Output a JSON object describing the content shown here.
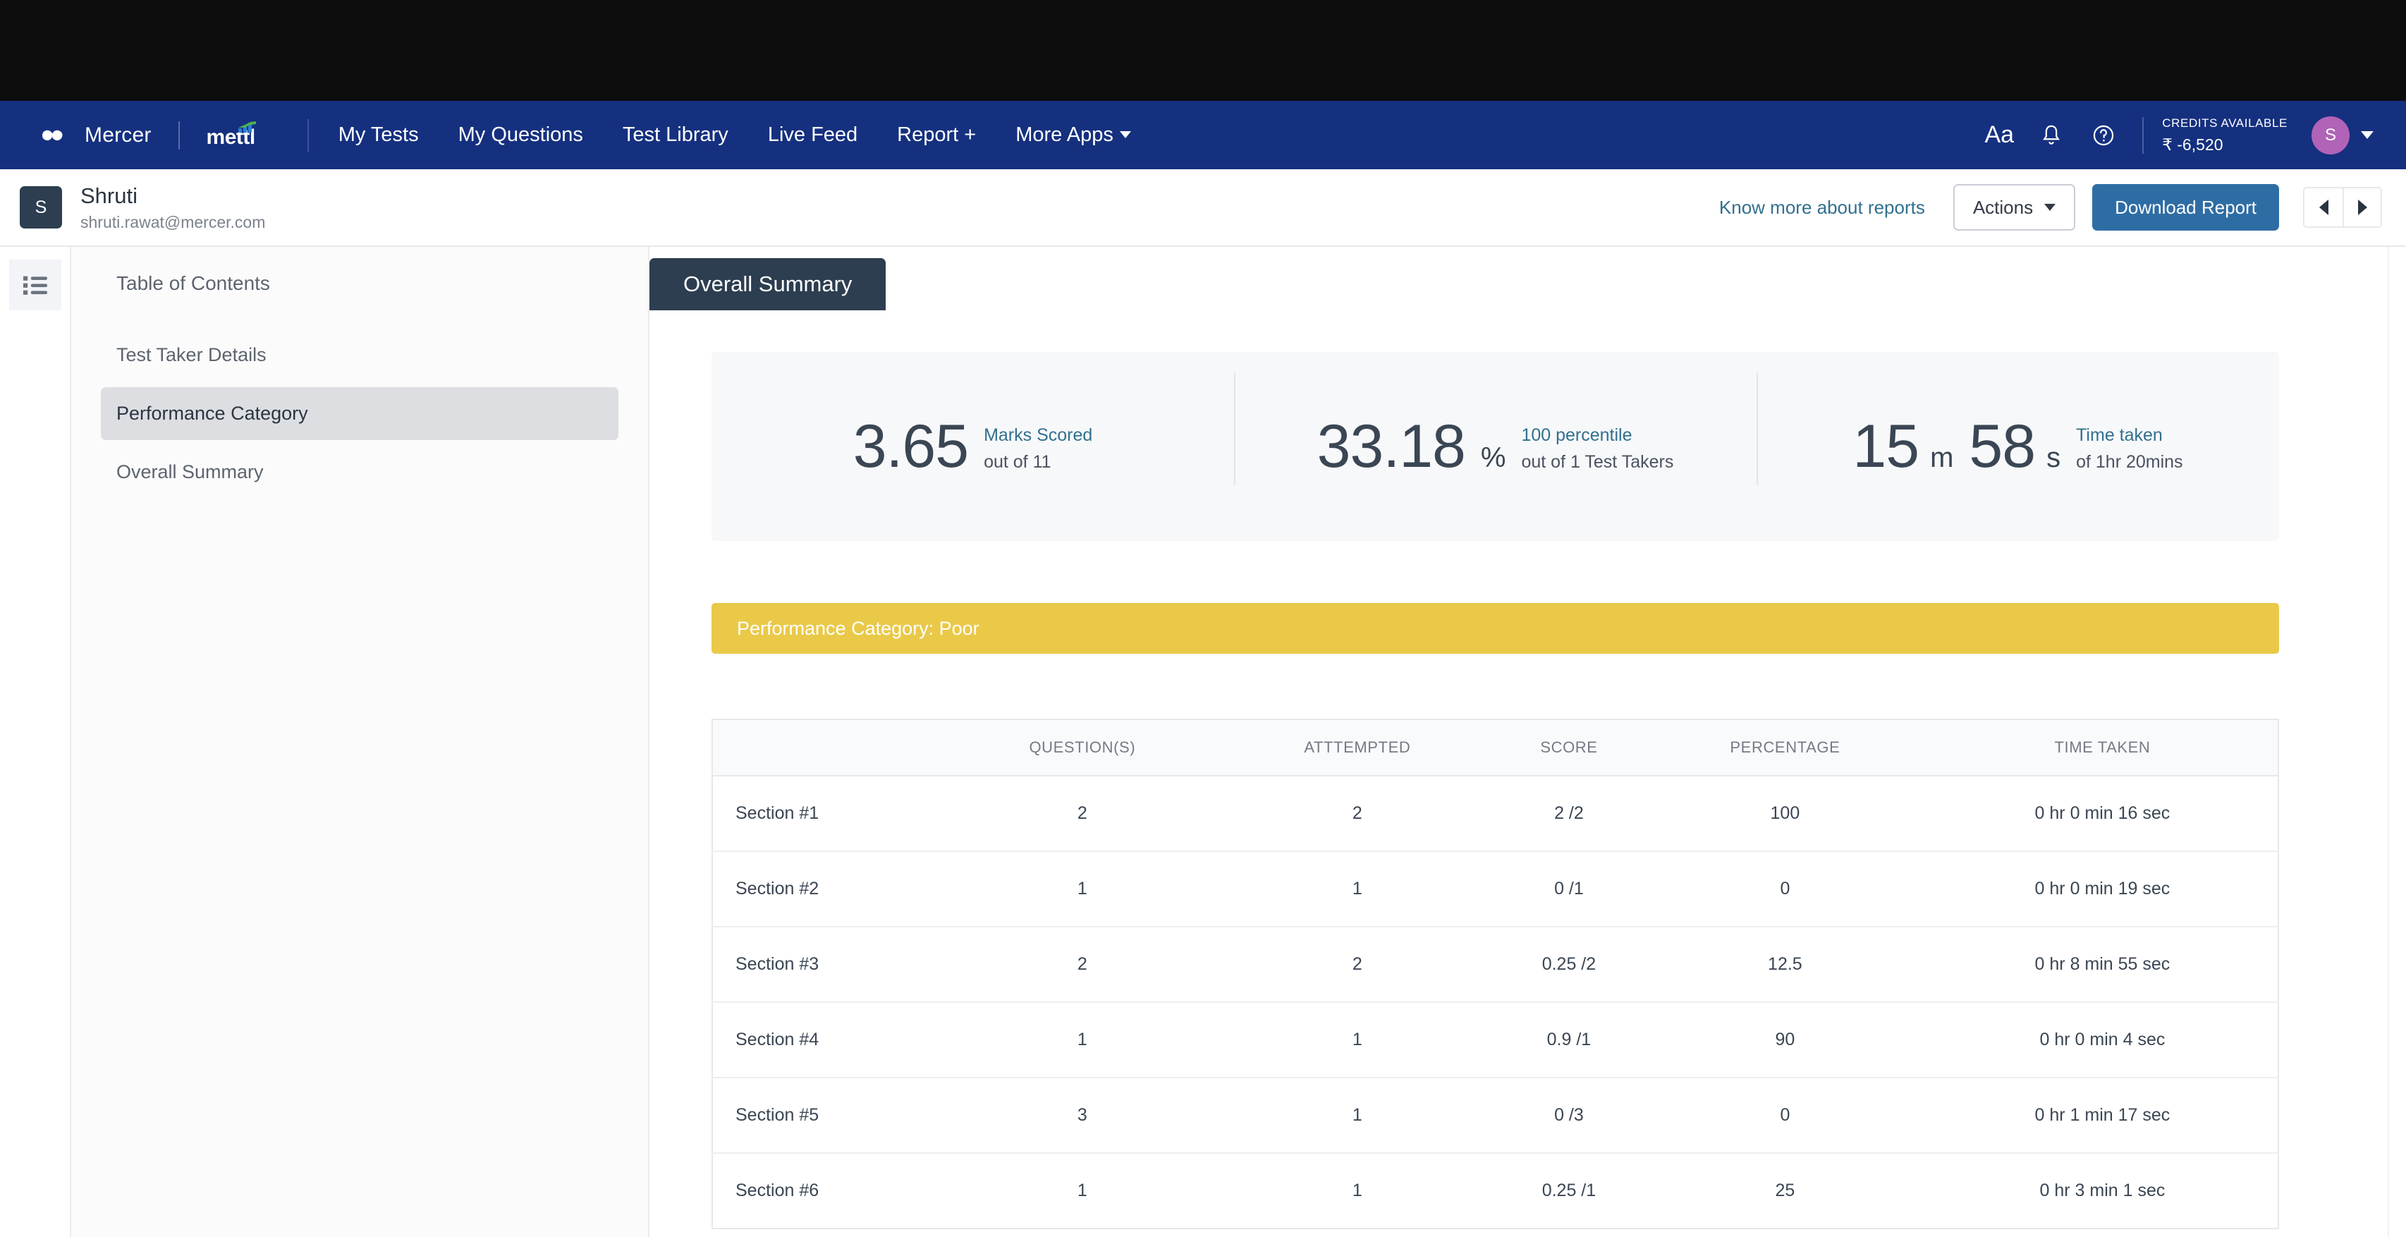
{
  "navbar": {
    "brand_mercer": "Mercer",
    "brand_mettl": "mettl",
    "links": [
      {
        "label": "My Tests",
        "has_caret": false
      },
      {
        "label": "My Questions",
        "has_caret": false
      },
      {
        "label": "Test Library",
        "has_caret": false
      },
      {
        "label": "Live Feed",
        "has_caret": false
      },
      {
        "label": "Report +",
        "has_caret": false
      },
      {
        "label": "More Apps",
        "has_caret": true
      }
    ],
    "icons": [
      "font-size-icon",
      "bell-icon",
      "help-icon"
    ],
    "font_icon_label": "Aa",
    "credits_label": "CREDITS AVAILABLE",
    "credits_value": "₹ -6,520",
    "avatar_initial": "S"
  },
  "user_header": {
    "avatar_initial": "S",
    "name": "Shruti",
    "email": "shruti.rawat@mercer.com",
    "know_more_label": "Know more about reports",
    "actions_label": "Actions",
    "download_label": "Download Report"
  },
  "sidebar": {
    "toc_title": "Table of Contents",
    "items": [
      {
        "label": "Test Taker Details",
        "active": false
      },
      {
        "label": "Performance Category",
        "active": true
      },
      {
        "label": "Overall Summary",
        "active": false
      }
    ]
  },
  "main": {
    "section_tab": "Overall Summary",
    "stats": [
      {
        "value": "3.65",
        "unit": "",
        "label1": "Marks Scored",
        "label2": "out of 11"
      },
      {
        "value": "33.18",
        "unit": "%",
        "label1": "100 percentile",
        "label2": "out of 1 Test Takers"
      },
      {
        "value_a": "15",
        "unit_a": "m",
        "value_b": "58",
        "unit_b": "s",
        "label1": "Time taken",
        "label2": "of 1hr 20mins"
      }
    ],
    "performance_banner": "Performance Category: Poor",
    "table": {
      "headers": [
        "",
        "QUESTION(S)",
        "ATTTEMPTED",
        "SCORE",
        "PERCENTAGE",
        "TIME TAKEN"
      ],
      "rows": [
        [
          "Section #1",
          "2",
          "2",
          "2 /2",
          "100",
          "0 hr 0 min 16 sec"
        ],
        [
          "Section #2",
          "1",
          "1",
          "0 /1",
          "0",
          "0 hr 0 min 19 sec"
        ],
        [
          "Section #3",
          "2",
          "2",
          "0.25 /2",
          "12.5",
          "0 hr 8 min 55 sec"
        ],
        [
          "Section #4",
          "1",
          "1",
          "0.9 /1",
          "90",
          "0 hr 0 min 4 sec"
        ],
        [
          "Section #5",
          "3",
          "1",
          "0 /3",
          "0",
          "0 hr 1 min 17 sec"
        ],
        [
          "Section #6",
          "1",
          "1",
          "0.25 /1",
          "25",
          "0 hr 3 min 1 sec"
        ]
      ]
    }
  },
  "colors": {
    "navbar_bg": "#15307f",
    "top_strip": "#0d0d0d",
    "accent_blue": "#31708f",
    "download_btn": "#2e6da4",
    "banner_yellow": "#eac949",
    "tab_dark": "#2c3e50",
    "avatar_purple": "#b163b8"
  }
}
